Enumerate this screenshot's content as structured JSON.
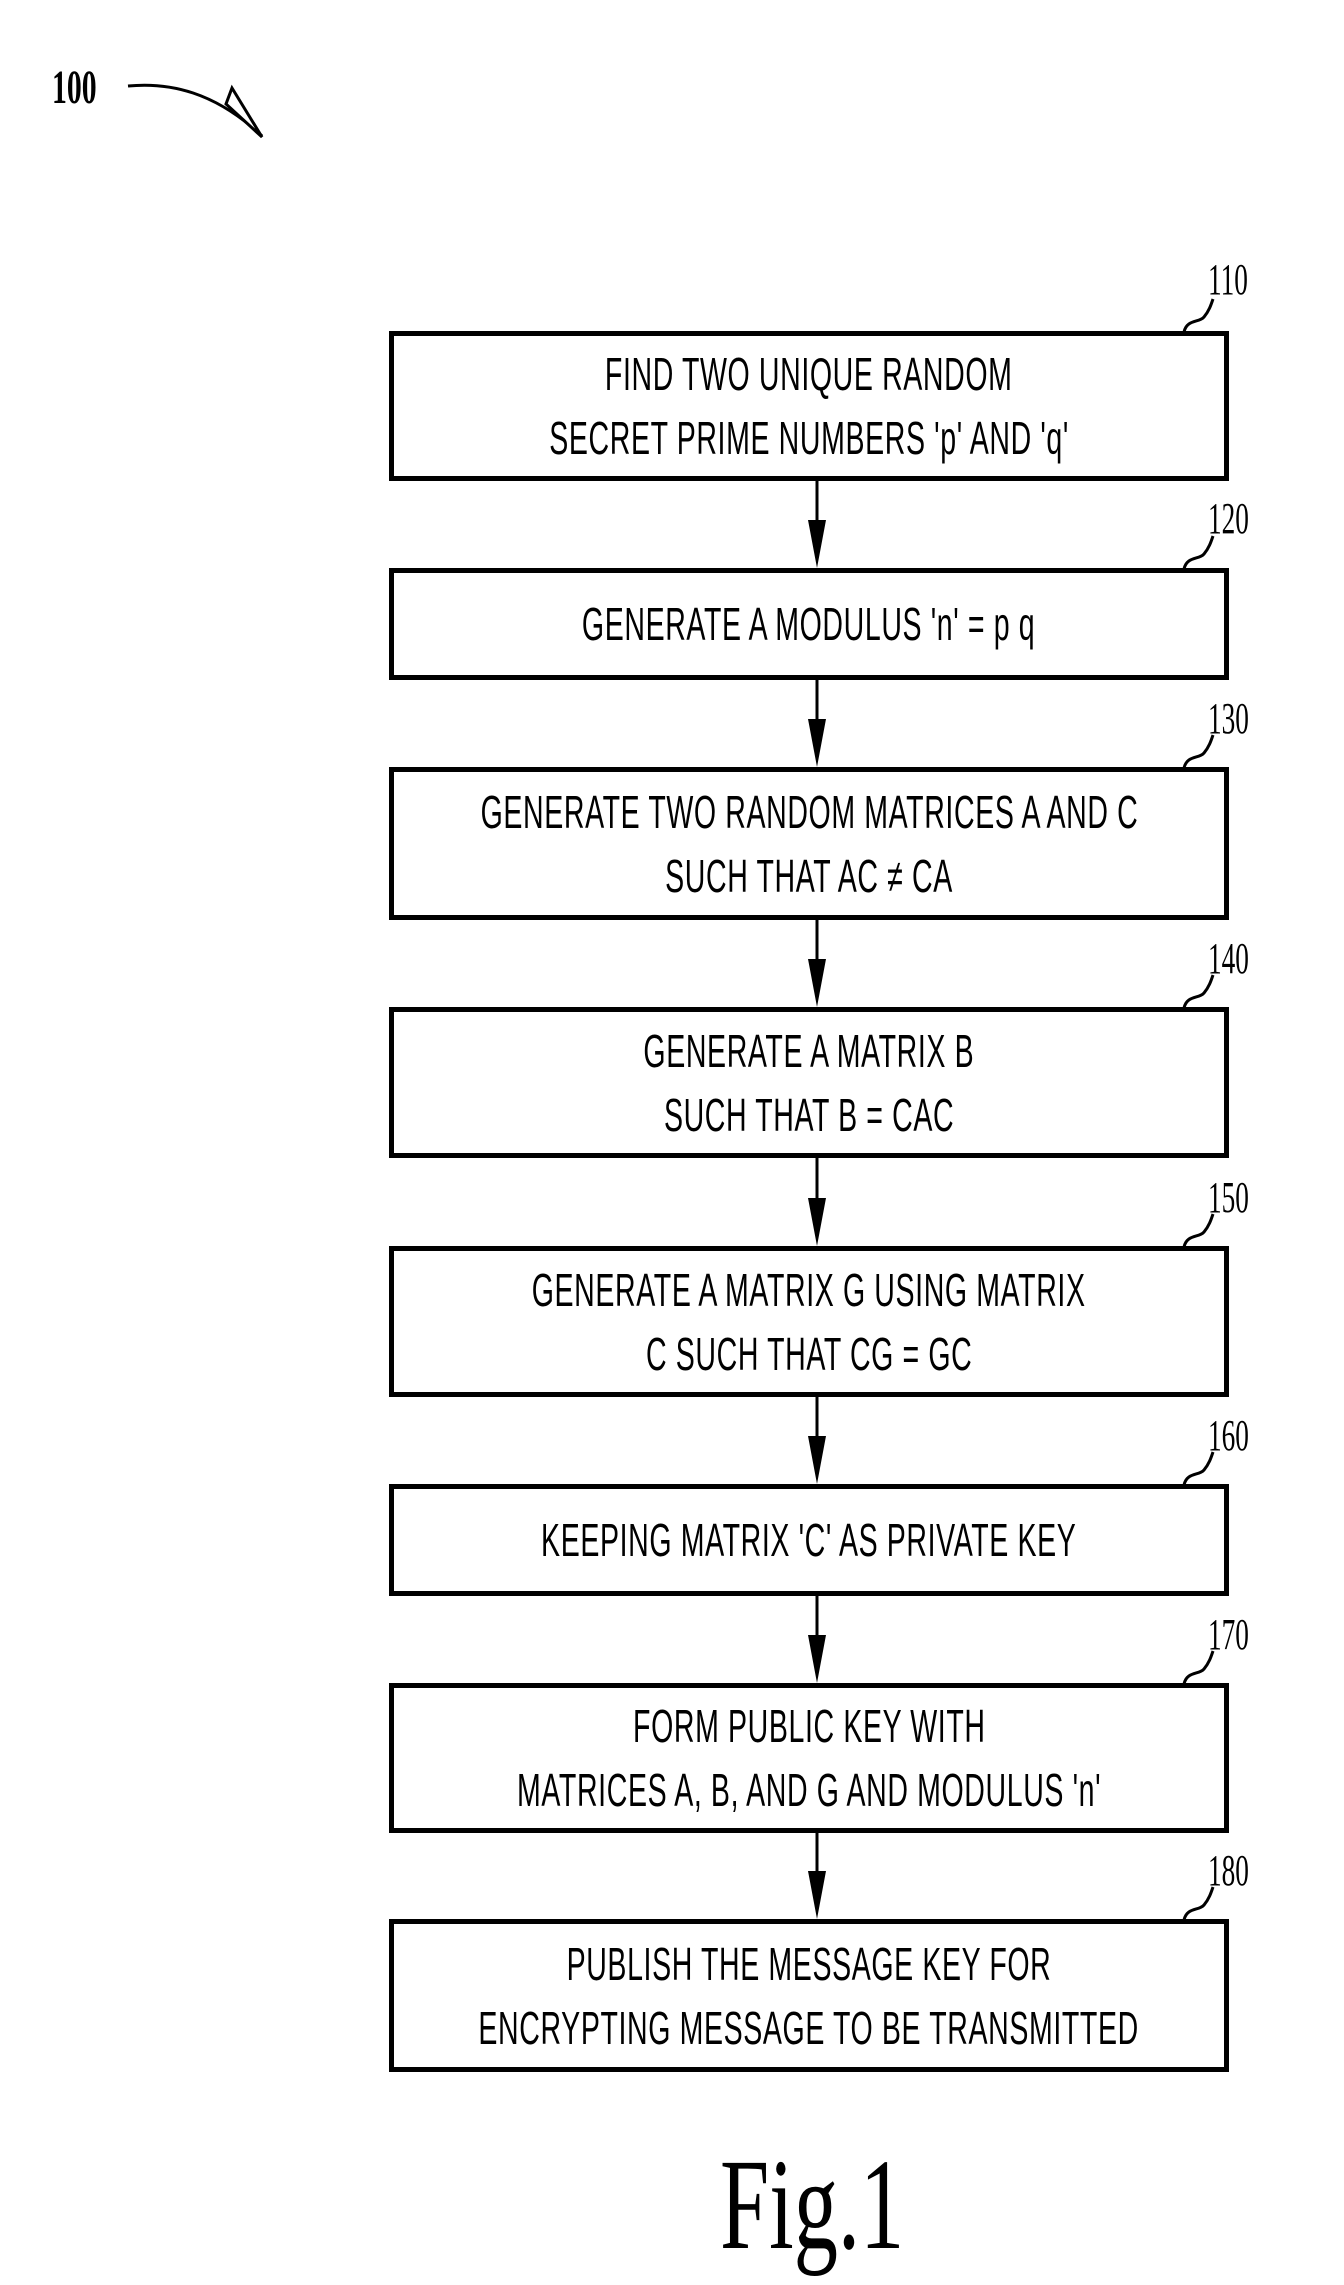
{
  "figure": {
    "reference": "100",
    "caption": "Fig.1"
  },
  "steps": [
    {
      "ref": "110",
      "lines": [
        "FIND TWO UNIQUE RANDOM",
        "SECRET PRIME NUMBERS 'p' AND 'q'"
      ]
    },
    {
      "ref": "120",
      "lines": [
        "GENERATE A MODULUS 'n' = p q"
      ]
    },
    {
      "ref": "130",
      "lines": [
        "GENERATE TWO RANDOM MATRICES A AND C",
        "SUCH THAT AC ≠ CA"
      ]
    },
    {
      "ref": "140",
      "lines": [
        "GENERATE A MATRIX B",
        "SUCH THAT B = CAC"
      ]
    },
    {
      "ref": "150",
      "lines": [
        "GENERATE A MATRIX G USING MATRIX",
        "C SUCH THAT CG = GC"
      ]
    },
    {
      "ref": "160",
      "lines": [
        "KEEPING MATRIX 'C' AS PRIVATE KEY"
      ]
    },
    {
      "ref": "170",
      "lines": [
        "FORM PUBLIC KEY WITH",
        "MATRICES A, B, AND G AND MODULUS 'n'"
      ]
    },
    {
      "ref": "180",
      "lines": [
        "PUBLISH THE MESSAGE KEY FOR",
        "ENCRYPTING MESSAGE TO BE TRANSMITTED"
      ]
    }
  ],
  "colors": {
    "ink": "#000000",
    "paper": "#ffffff"
  }
}
